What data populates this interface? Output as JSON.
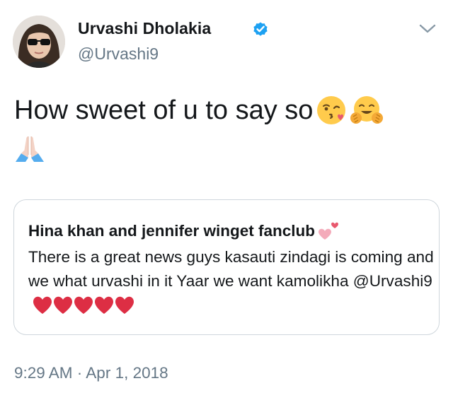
{
  "profile": {
    "display_name": "Urvashi Dholakia",
    "handle": "@Urvashi9",
    "verified": true,
    "avatar_icon": "profile-photo"
  },
  "tweet": {
    "text_line1": "How sweet of u to say so",
    "emojis": [
      "face-blowing-kiss",
      "hugging-face",
      "folded-hands"
    ]
  },
  "quoted_tweet": {
    "author": "Hina khan and jennifer winget fanclub",
    "author_emoji": "revolving-hearts",
    "text": "There is a great news guys kasauti zindagi is coming and we what urvashi in it Yaar we want kamolikha @Urvashi9",
    "trailing_emojis": [
      "red-heart",
      "red-heart",
      "red-heart",
      "red-heart",
      "red-heart"
    ]
  },
  "meta": {
    "timestamp": "9:29 AM · Apr 1, 2018"
  },
  "colors": {
    "primary_text": "#14171a",
    "secondary_text": "#657786",
    "verified_blue": "#1da1f2",
    "border": "#cfd6dc",
    "heart_red": "#dd2e44"
  }
}
